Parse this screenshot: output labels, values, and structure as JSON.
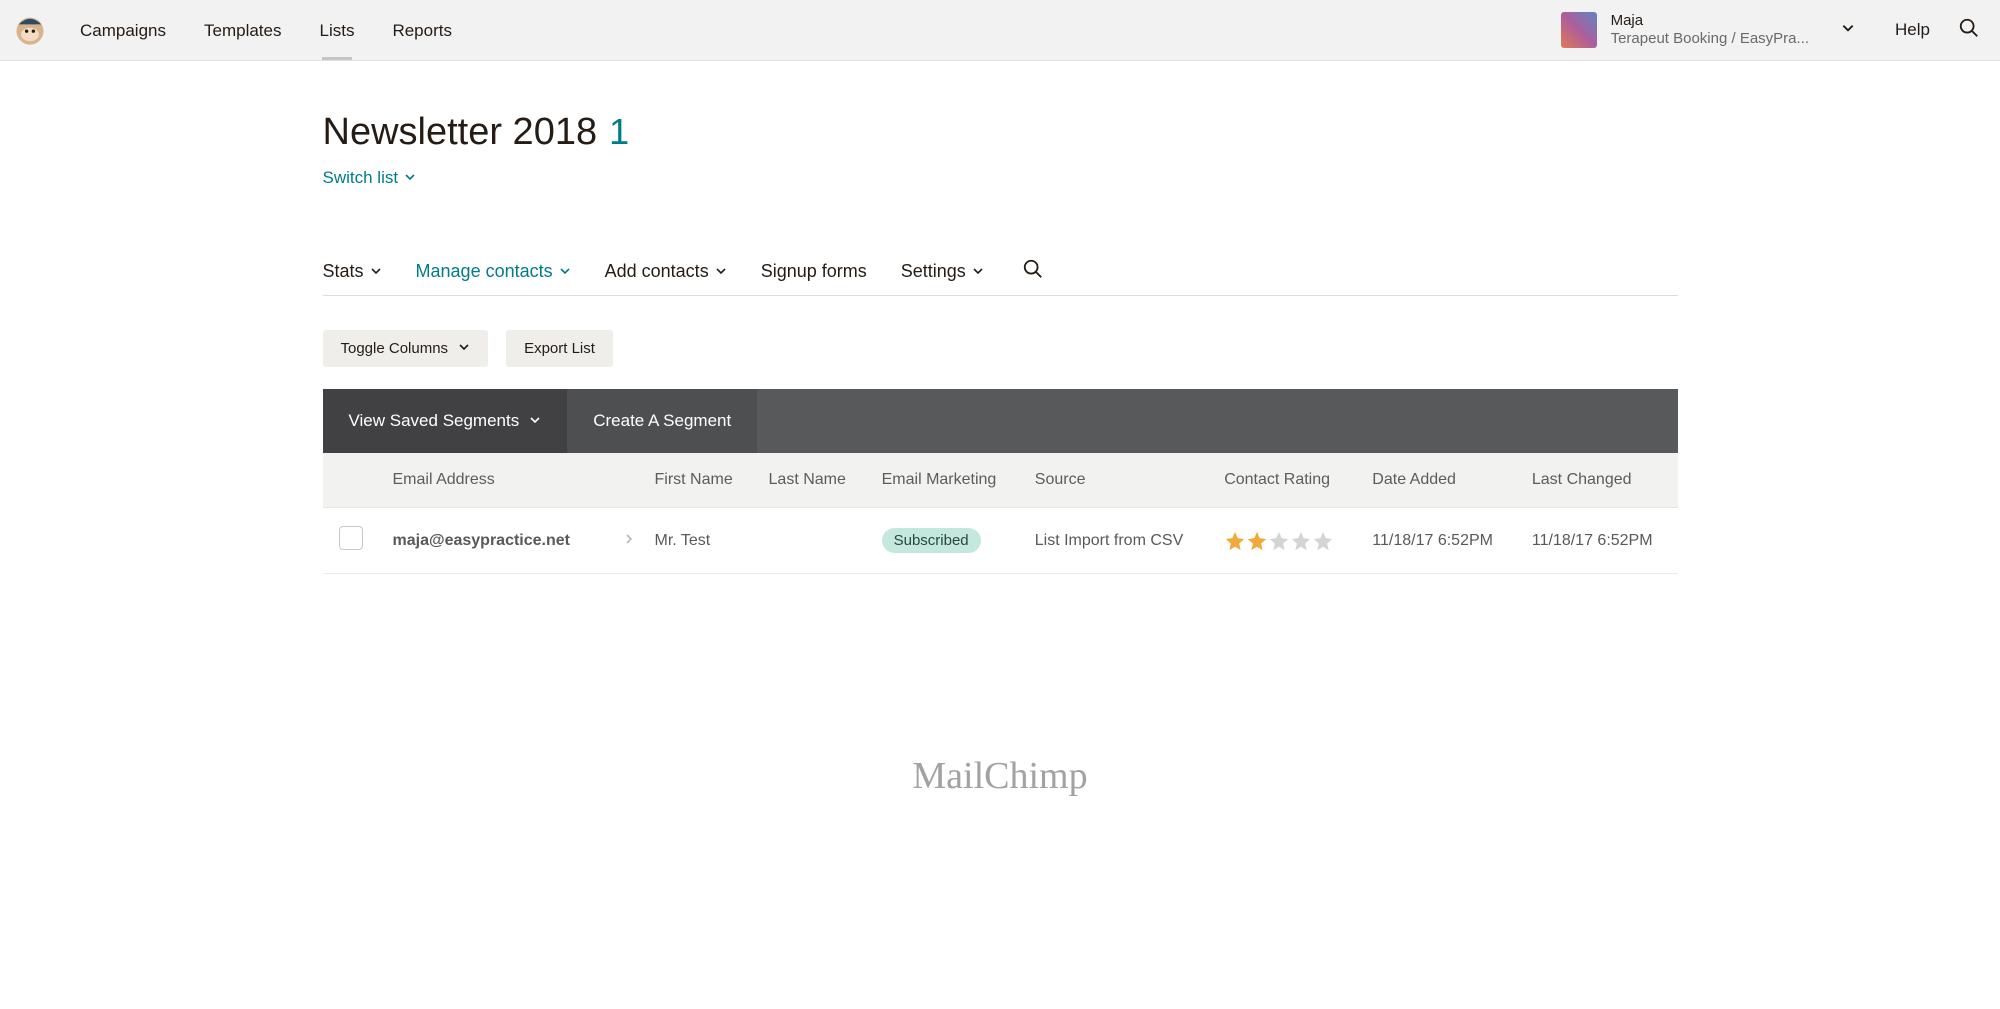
{
  "nav": {
    "campaigns": "Campaigns",
    "templates": "Templates",
    "lists": "Lists",
    "reports": "Reports"
  },
  "account": {
    "name": "Maja",
    "org": "Terapeut Booking / EasyPra...",
    "help": "Help"
  },
  "page": {
    "title": "Newsletter 2018",
    "count": "1",
    "switch_list": "Switch list"
  },
  "subnav": {
    "stats": "Stats",
    "manage": "Manage contacts",
    "add": "Add contacts",
    "signup": "Signup forms",
    "settings": "Settings"
  },
  "toolbar": {
    "toggle_columns": "Toggle Columns",
    "export_list": "Export List"
  },
  "segments": {
    "view_saved": "View Saved Segments",
    "create": "Create A Segment"
  },
  "columns": {
    "email": "Email Address",
    "first_name": "First Name",
    "last_name": "Last Name",
    "email_marketing": "Email Marketing",
    "source": "Source",
    "rating": "Contact Rating",
    "date_added": "Date Added",
    "last_changed": "Last Changed"
  },
  "rows": [
    {
      "email": "maja@easypractice.net",
      "first_name": "Mr. Test",
      "last_name": "",
      "email_marketing": "Subscribed",
      "source": "List Import from CSV",
      "rating": 2,
      "date_added": "11/18/17 6:52PM",
      "last_changed": "11/18/17 6:52PM"
    }
  ],
  "footer": {
    "brand": "MailChimp"
  }
}
